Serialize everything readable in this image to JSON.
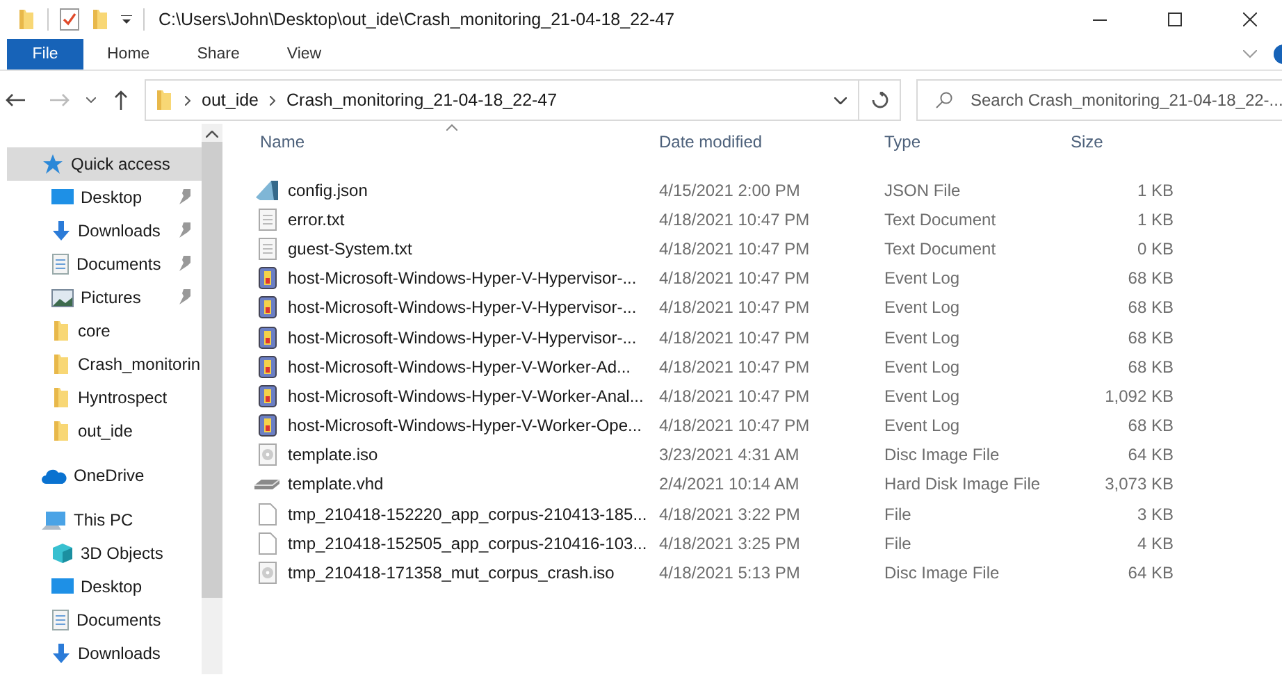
{
  "window": {
    "title": "C:\\Users\\John\\Desktop\\out_ide\\Crash_monitoring_21-04-18_22-47"
  },
  "ribbon_tabs": [
    {
      "label": "File",
      "kind": "file"
    },
    {
      "label": "Home",
      "kind": "tab"
    },
    {
      "label": "Share",
      "kind": "tab"
    },
    {
      "label": "View",
      "kind": "tab"
    }
  ],
  "address": {
    "crumbs": [
      "out_ide",
      "Crash_monitoring_21-04-18_22-47"
    ]
  },
  "search": {
    "placeholder": "Search Crash_monitoring_21-04-18_22-..."
  },
  "sidebar": {
    "items": [
      {
        "label": "Quick access",
        "kind": "quick",
        "selected": true,
        "children": [
          {
            "label": "Desktop",
            "kind": "desktop",
            "pinned": true,
            "selected": false
          },
          {
            "label": "Downloads",
            "kind": "downloads",
            "pinned": true,
            "selected": false
          },
          {
            "label": "Documents",
            "kind": "documents",
            "pinned": true,
            "selected": false
          },
          {
            "label": "Pictures",
            "kind": "pictures",
            "pinned": true,
            "selected": false
          },
          {
            "label": "core",
            "kind": "folder",
            "pinned": false,
            "selected": false
          },
          {
            "label": "Crash_monitorin",
            "kind": "folder",
            "pinned": false,
            "selected": false
          },
          {
            "label": "Hyntrospect",
            "kind": "folder",
            "pinned": false,
            "selected": false
          },
          {
            "label": "out_ide",
            "kind": "folder",
            "pinned": false,
            "selected": false
          }
        ]
      },
      {
        "label": "OneDrive",
        "kind": "onedrive",
        "selected": false
      },
      {
        "label": "This PC",
        "kind": "pc",
        "selected": false,
        "children": [
          {
            "label": "3D Objects",
            "kind": "objects3d",
            "pinned": false,
            "selected": false
          },
          {
            "label": "Desktop",
            "kind": "desktop",
            "pinned": false,
            "selected": false
          },
          {
            "label": "Documents",
            "kind": "documents",
            "pinned": false,
            "selected": false
          },
          {
            "label": "Downloads",
            "kind": "downloads",
            "pinned": false,
            "selected": false
          }
        ]
      }
    ]
  },
  "table": {
    "columns": [
      {
        "label": "Name",
        "sorted": true
      },
      {
        "label": "Date modified",
        "sorted": false
      },
      {
        "label": "Type",
        "sorted": false
      },
      {
        "label": "Size",
        "sorted": false
      }
    ],
    "rows": [
      {
        "kind": "json",
        "name": "config.json",
        "date": "4/15/2021 2:00 PM",
        "type": "JSON File",
        "size": "1 KB"
      },
      {
        "kind": "text",
        "name": "error.txt",
        "date": "4/18/2021 10:47 PM",
        "type": "Text Document",
        "size": "1 KB"
      },
      {
        "kind": "text",
        "name": "guest-System.txt",
        "date": "4/18/2021 10:47 PM",
        "type": "Text Document",
        "size": "0 KB"
      },
      {
        "kind": "eventlog",
        "name": "host-Microsoft-Windows-Hyper-V-Hypervisor-...",
        "date": "4/18/2021 10:47 PM",
        "type": "Event Log",
        "size": "68 KB"
      },
      {
        "kind": "eventlog",
        "name": "host-Microsoft-Windows-Hyper-V-Hypervisor-...",
        "date": "4/18/2021 10:47 PM",
        "type": "Event Log",
        "size": "68 KB"
      },
      {
        "kind": "eventlog",
        "name": "host-Microsoft-Windows-Hyper-V-Hypervisor-...",
        "date": "4/18/2021 10:47 PM",
        "type": "Event Log",
        "size": "68 KB"
      },
      {
        "kind": "eventlog",
        "name": "host-Microsoft-Windows-Hyper-V-Worker-Ad...",
        "date": "4/18/2021 10:47 PM",
        "type": "Event Log",
        "size": "68 KB"
      },
      {
        "kind": "eventlog",
        "name": "host-Microsoft-Windows-Hyper-V-Worker-Anal...",
        "date": "4/18/2021 10:47 PM",
        "type": "Event Log",
        "size": "1,092 KB"
      },
      {
        "kind": "eventlog",
        "name": "host-Microsoft-Windows-Hyper-V-Worker-Ope...",
        "date": "4/18/2021 10:47 PM",
        "type": "Event Log",
        "size": "68 KB"
      },
      {
        "kind": "disc",
        "name": "template.iso",
        "date": "3/23/2021 4:31 AM",
        "type": "Disc Image File",
        "size": "64 KB"
      },
      {
        "kind": "vhd",
        "name": "template.vhd",
        "date": "2/4/2021 10:14 AM",
        "type": "Hard Disk Image File",
        "size": "3,073 KB"
      },
      {
        "kind": "file",
        "name": "tmp_210418-152220_app_corpus-210413-185...",
        "date": "4/18/2021 3:22 PM",
        "type": "File",
        "size": "3 KB"
      },
      {
        "kind": "file",
        "name": "tmp_210418-152505_app_corpus-210416-103...",
        "date": "4/18/2021 3:25 PM",
        "type": "File",
        "size": "4 KB"
      },
      {
        "kind": "disc",
        "name": "tmp_210418-171358_mut_corpus_crash.iso",
        "date": "4/18/2021 5:13 PM",
        "type": "Disc Image File",
        "size": "64 KB"
      }
    ]
  }
}
